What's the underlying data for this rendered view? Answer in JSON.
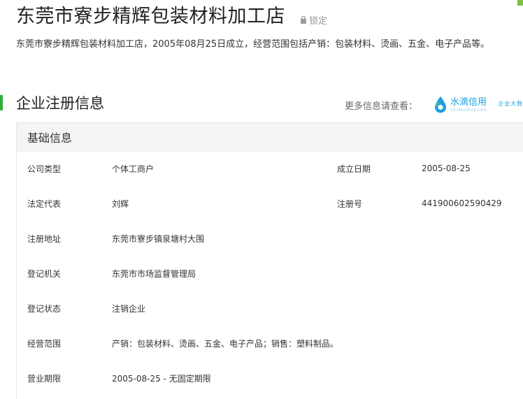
{
  "company": {
    "name": "东莞市寮步精辉包装材料加工店",
    "lock_label": "锁定",
    "description": "东莞市寮步精辉包装材料加工店，2005年08月25日成立，经营范围包括产销：包装材料、烫画、五金、电子产品等。"
  },
  "section": {
    "title": "企业注册信息",
    "more_info": "更多信息请查看：",
    "brand_name": "水滴信用",
    "brand_url": "sd.shuidixy.com",
    "brand_slogan": "企业大数据",
    "card_title": "基础信息"
  },
  "info": {
    "company_type_label": "公司类型",
    "company_type": "个体工商户",
    "established_label": "成立日期",
    "established": "2005-08-25",
    "legal_rep_label": "法定代表",
    "legal_rep": "刘辉",
    "reg_no_label": "注册号",
    "reg_no": "441900602590429",
    "address_label": "注册地址",
    "address": "东莞市寮步镇泉塘村大围",
    "authority_label": "登记机关",
    "authority": "东莞市市场监督管理局",
    "status_label": "登记状态",
    "status": "注销企业",
    "scope_label": "经营范围",
    "scope": "产销：包装材料、烫画、五金、电子产品；销售：塑料制品。",
    "term_label": "营业期限",
    "term": "2005-08-25 - 无固定期限"
  },
  "colors": {
    "accent_green": "#2fae3c",
    "brand_blue": "#1a9fe0"
  }
}
